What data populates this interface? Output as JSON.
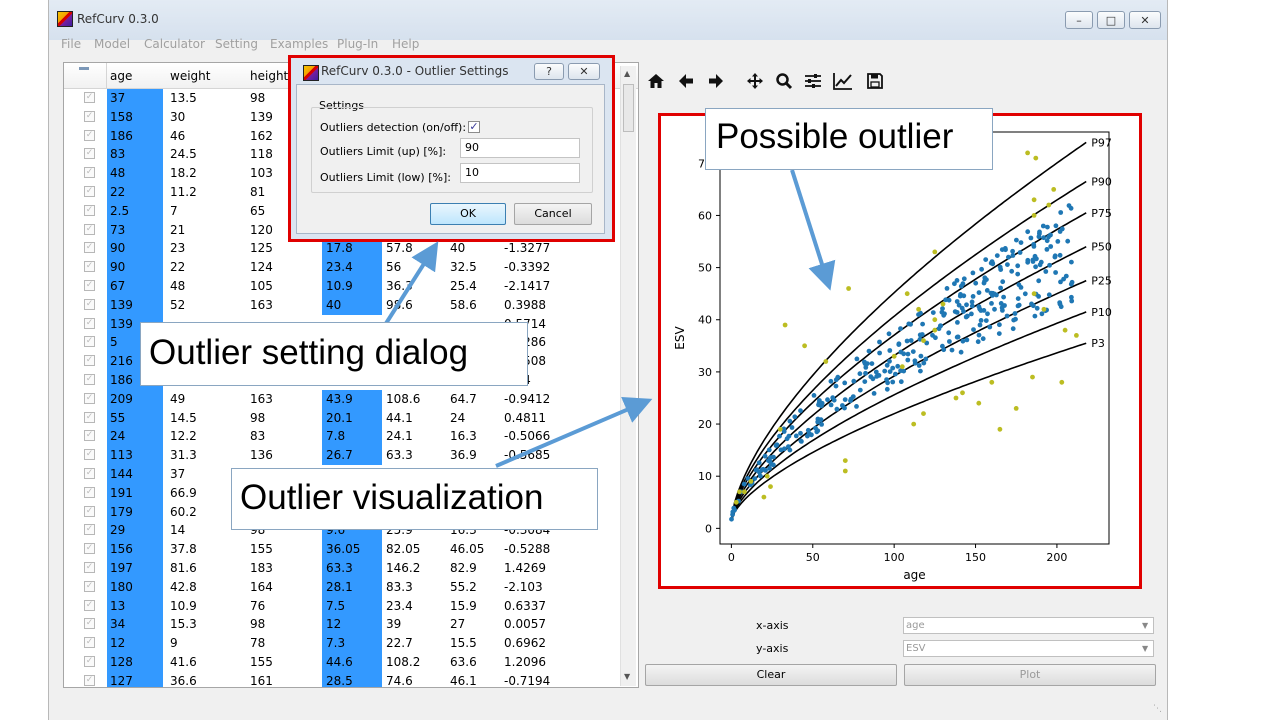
{
  "window": {
    "title": "RefCurv 0.3.0"
  },
  "menu": [
    "File",
    "Model",
    "Calculator",
    "Setting",
    "Examples",
    "Plug-In",
    "Help"
  ],
  "table": {
    "headers": [
      "age",
      "weight",
      "height"
    ],
    "rows": [
      [
        "37",
        "13.5",
        "98",
        "",
        "",
        "",
        ""
      ],
      [
        "158",
        "30",
        "139",
        "",
        "",
        "",
        ""
      ],
      [
        "186",
        "46",
        "162",
        "",
        "",
        "",
        ""
      ],
      [
        "83",
        "24.5",
        "118",
        "",
        "",
        "",
        ""
      ],
      [
        "48",
        "18.2",
        "103",
        "",
        "",
        "",
        ""
      ],
      [
        "22",
        "11.2",
        "81",
        "",
        "",
        "",
        ""
      ],
      [
        "2.5",
        "7",
        "65",
        "",
        "",
        "",
        ""
      ],
      [
        "73",
        "21",
        "120",
        "",
        "",
        "",
        ""
      ],
      [
        "90",
        "23",
        "125",
        "17.8",
        "57.8",
        "40",
        "-1.3277"
      ],
      [
        "90",
        "22",
        "124",
        "23.4",
        "56",
        "32.5",
        "-0.3392"
      ],
      [
        "67",
        "48",
        "105",
        "10.9",
        "36.3",
        "25.4",
        "-2.1417"
      ],
      [
        "139",
        "52",
        "163",
        "40",
        "98.6",
        "58.6",
        "0.3988"
      ],
      [
        "139",
        "",
        "",
        "",
        "",
        "",
        "0.5714"
      ],
      [
        "5",
        "",
        "",
        "",
        "",
        "",
        "0.4286"
      ],
      [
        "216",
        "",
        "",
        "",
        "",
        "",
        "0.1508"
      ],
      [
        "186",
        "",
        "",
        "",
        "",
        "",
        "0.14"
      ],
      [
        "209",
        "49",
        "163",
        "43.9",
        "108.6",
        "64.7",
        "-0.9412"
      ],
      [
        "55",
        "14.5",
        "98",
        "20.1",
        "44.1",
        "24",
        "0.4811"
      ],
      [
        "24",
        "12.2",
        "83",
        "7.8",
        "24.1",
        "16.3",
        "-0.5066"
      ],
      [
        "113",
        "31.3",
        "136",
        "26.7",
        "63.3",
        "36.9",
        "-0.5685"
      ],
      [
        "144",
        "37",
        "",
        "",
        "",
        "",
        ""
      ],
      [
        "191",
        "66.9",
        "",
        "",
        "",
        "",
        ""
      ],
      [
        "179",
        "60.2",
        "",
        "",
        "",
        "",
        ""
      ],
      [
        "29",
        "14",
        "98",
        "9.6",
        "25.9",
        "16.3",
        "-0.3084"
      ],
      [
        "156",
        "37.8",
        "155",
        "36.05",
        "82.05",
        "46.05",
        "-0.5288"
      ],
      [
        "197",
        "81.6",
        "183",
        "63.3",
        "146.2",
        "82.9",
        "1.4269"
      ],
      [
        "180",
        "42.8",
        "164",
        "28.1",
        "83.3",
        "55.2",
        "-2.103"
      ],
      [
        "13",
        "10.9",
        "76",
        "7.5",
        "23.4",
        "15.9",
        "0.6337"
      ],
      [
        "34",
        "15.3",
        "98",
        "12",
        "39",
        "27",
        "0.0057"
      ],
      [
        "12",
        "9",
        "78",
        "7.3",
        "22.7",
        "15.5",
        "0.6962"
      ],
      [
        "128",
        "41.6",
        "155",
        "44.6",
        "108.2",
        "63.6",
        "1.2096"
      ],
      [
        "127",
        "36.6",
        "161",
        "28.5",
        "74.6",
        "46.1",
        "-0.7194"
      ]
    ]
  },
  "dialog": {
    "title": "RefCurv 0.3.0 - Outlier Settings",
    "help_label": "?",
    "close_label": "✕",
    "group_label": "Settings",
    "detection_label": "Outliers detection (on/off):",
    "detection_checked": true,
    "up_label": "Outliers Limit (up) [%]:",
    "up_value": "90",
    "low_label": "Outliers Limit (low) [%]:",
    "low_value": "10",
    "ok_label": "OK",
    "cancel_label": "Cancel"
  },
  "controls": {
    "xaxis_label": "x-axis",
    "xaxis_value": "age",
    "yaxis_label": "y-axis",
    "yaxis_value": "ESV",
    "clear_label": "Clear",
    "plot_label": "Plot"
  },
  "toolbar_icons": [
    "home-icon",
    "back-arrow-icon",
    "forward-arrow-icon",
    "pan-icon",
    "zoom-icon",
    "configure-subplots-icon",
    "edit-axis-icon",
    "save-icon"
  ],
  "callouts": {
    "possible_outlier": "Possible outlier",
    "dialog": "Outlier setting dialog",
    "visualization": "Outlier visualization"
  },
  "colors": {
    "selection": "#3399ff",
    "highlight_frame": "#e00000",
    "inlier": "#1f77b4",
    "outlier": "#bcbd22",
    "arrow": "#5b9bd5"
  },
  "chart_data": {
    "type": "scatter",
    "xlabel": "age",
    "ylabel": "ESV",
    "xlim": [
      -7,
      232
    ],
    "ylim": [
      -3,
      76
    ],
    "xticks": [
      0,
      50,
      100,
      150,
      200
    ],
    "yticks": [
      0,
      10,
      20,
      30,
      40,
      50,
      60,
      70
    ],
    "percentile_curves": [
      {
        "name": "P97",
        "end": [
          218,
          74
        ]
      },
      {
        "name": "P90",
        "end": [
          218,
          66.5
        ]
      },
      {
        "name": "P75",
        "end": [
          218,
          60.5
        ]
      },
      {
        "name": "P50",
        "end": [
          218,
          54
        ]
      },
      {
        "name": "P25",
        "end": [
          218,
          47.5
        ]
      },
      {
        "name": "P10",
        "end": [
          218,
          41.5
        ]
      },
      {
        "name": "P3",
        "end": [
          218,
          35.5
        ]
      }
    ],
    "outliers": [
      [
        72,
        46
      ],
      [
        33,
        39
      ],
      [
        45,
        35
      ],
      [
        58,
        32
      ],
      [
        30,
        19
      ],
      [
        70,
        13
      ],
      [
        70,
        11
      ],
      [
        100,
        33
      ],
      [
        105,
        31
      ],
      [
        118,
        36
      ],
      [
        125,
        38
      ],
      [
        125,
        40
      ],
      [
        130,
        43
      ],
      [
        112,
        20
      ],
      [
        118,
        22
      ],
      [
        138,
        25
      ],
      [
        142,
        26
      ],
      [
        152,
        24
      ],
      [
        160,
        28
      ],
      [
        175,
        23
      ],
      [
        165,
        19
      ],
      [
        185,
        29
      ],
      [
        192,
        42
      ],
      [
        186,
        45
      ],
      [
        205,
        38
      ],
      [
        212,
        37
      ],
      [
        203,
        28
      ],
      [
        182,
        72
      ],
      [
        187,
        71
      ],
      [
        186,
        63
      ],
      [
        186,
        60
      ],
      [
        195,
        62
      ],
      [
        198,
        65
      ],
      [
        155,
        71
      ],
      [
        125,
        53
      ],
      [
        115,
        42
      ],
      [
        108,
        45
      ],
      [
        22,
        10
      ],
      [
        24,
        8
      ],
      [
        20,
        6
      ],
      [
        3,
        5
      ],
      [
        5,
        7
      ],
      [
        8,
        7
      ],
      [
        12,
        9
      ]
    ]
  }
}
